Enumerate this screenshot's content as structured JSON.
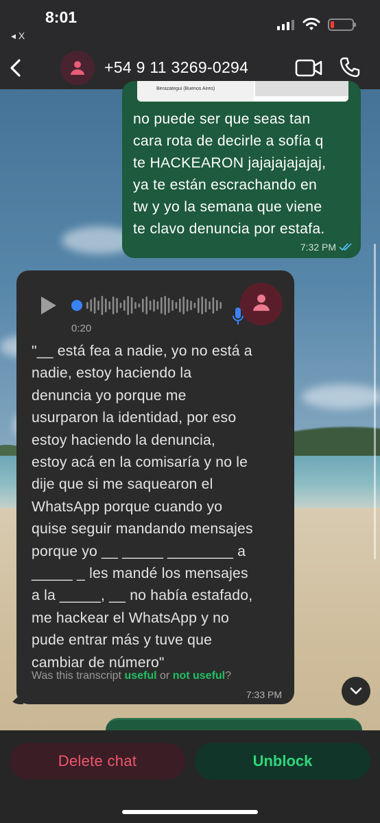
{
  "status_bar": {
    "time": "8:01",
    "back_app": "◂ X"
  },
  "header": {
    "contact": "+54 9 11 3269-0294"
  },
  "outgoing": {
    "thumbnail_caption": "Berazategui (Buenos Aires)",
    "text": "no puede ser que seas tan\ncara rota de decirle a sofía q\nte HACKEARON  jajajajajajaj,\nya te están escrachando en\ntw y yo la semana que viene\nte clavo denuncia por estafa.",
    "time": "7:32 PM",
    "read_color": "#53bdeb"
  },
  "voice_message": {
    "duration": "0:20",
    "transcript_lines": [
      "\"__ está fea a nadie, yo no está a",
      "nadie, estoy haciendo la",
      "denuncia yo porque me",
      "usurparon la identidad, por eso",
      "estoy haciendo la denuncia,",
      "estoy acá en la comisaría y no le",
      "dije que si me saquearon el",
      "WhatsApp porque cuando yo",
      "quise seguir mandando mensajes",
      "porque yo __ _____ ________ a",
      "_____ _ les mandé los mensajes",
      "a la _____, __ no había estafado,",
      "me hackear el WhatsApp y no",
      "pude entrar más y tuve que",
      "cambiar de número\""
    ],
    "feedback_prefix": "Was this transcript ",
    "feedback_useful": "useful",
    "feedback_or": " or ",
    "feedback_not_useful": "not useful",
    "feedback_suffix": "?",
    "time": "7:33 PM"
  },
  "actions": {
    "delete_label": "Delete chat",
    "unblock_label": "Unblock"
  },
  "colors": {
    "outgoing_bubble": "#1e5a3d",
    "incoming_bubble": "#2b2b2b",
    "accent_green": "#21c063",
    "delete_red": "#f0566e",
    "mic_blue": "#3b82f6"
  }
}
